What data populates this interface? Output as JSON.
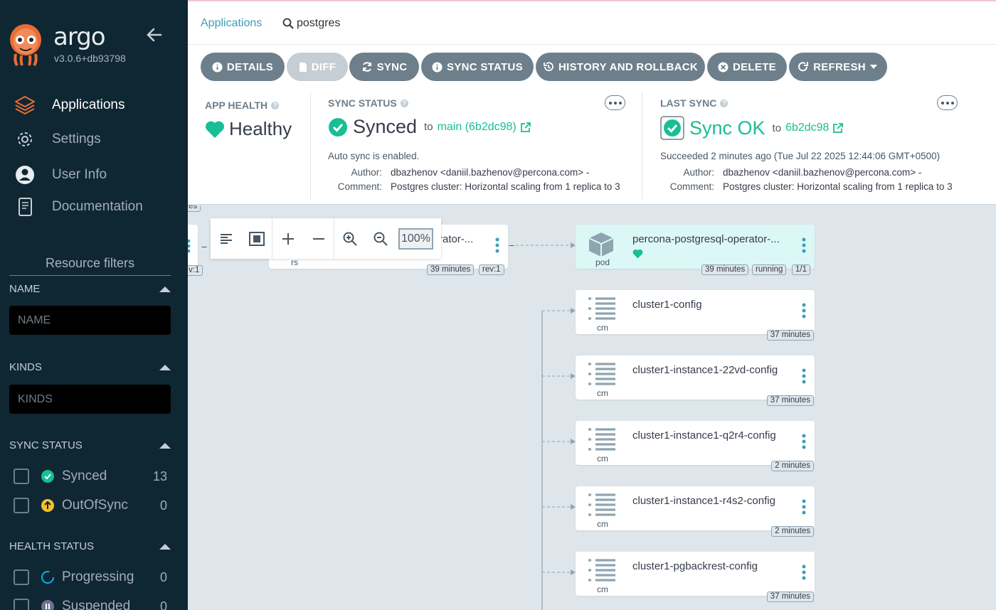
{
  "app": {
    "name": "argo",
    "version": "v3.0.6+db93798"
  },
  "nav": {
    "items": [
      {
        "label": "Applications",
        "icon": "layers-icon",
        "active": true
      },
      {
        "label": "Settings",
        "icon": "gear-icon"
      },
      {
        "label": "User Info",
        "icon": "user-icon"
      },
      {
        "label": "Documentation",
        "icon": "book-icon"
      }
    ]
  },
  "filters": {
    "title": "Resource filters",
    "name": {
      "label": "NAME",
      "placeholder": "NAME"
    },
    "kinds": {
      "label": "KINDS",
      "placeholder": "KINDS"
    },
    "sync_status": {
      "label": "SYNC STATUS",
      "items": [
        {
          "label": "Synced",
          "count": "13",
          "icon": "check-circle-icon",
          "color": "#18be94"
        },
        {
          "label": "OutOfSync",
          "count": "0",
          "icon": "arrow-up-circle-icon",
          "color": "#f4c030"
        }
      ]
    },
    "health_status": {
      "label": "HEALTH STATUS",
      "items": [
        {
          "label": "Progressing",
          "count": "0",
          "icon": "spinner-icon",
          "color": "#0dadea"
        },
        {
          "label": "Suspended",
          "count": "0",
          "icon": "pause-circle-icon",
          "color": "#766f94"
        }
      ]
    }
  },
  "breadcrumb": {
    "root": "Applications",
    "current": "postgres"
  },
  "toolbar": {
    "details": "DETAILS",
    "diff": "DIFF",
    "sync": "SYNC",
    "sync_status": "SYNC STATUS",
    "history": "HISTORY AND ROLLBACK",
    "delete": "DELETE",
    "refresh": "REFRESH"
  },
  "app_health": {
    "label": "APP HEALTH",
    "status": "Healthy",
    "color": "#18be94"
  },
  "sync_status": {
    "label": "SYNC STATUS",
    "status": "Synced",
    "to": "to",
    "revision": "main (6b2dc98)",
    "auto_sync": "Auto sync is enabled.",
    "author_label": "Author:",
    "author": "dbazhenov <daniil.bazhenov@percona.com> -",
    "comment_label": "Comment:",
    "comment": "Postgres cluster: Horizontal scaling from 1 replica to 3"
  },
  "last_sync": {
    "label": "LAST SYNC",
    "status": "Sync OK",
    "to": "to",
    "revision": "6b2dc98",
    "succeeded": "Succeeded 2 minutes ago (Tue Jul 22 2025 12:44:06 GMT+0500)",
    "author_label": "Author:",
    "author": "dbazhenov <daniil.bazhenov@percona.com> -",
    "comment_label": "Comment:",
    "comment": "Postgres cluster: Horizontal scaling from 1 replica to 3"
  },
  "zoom": {
    "level": "100%"
  },
  "graph": {
    "left_partial": {
      "top": "es",
      "rev": "v:1"
    },
    "rs_node": {
      "name": "rator-...",
      "kind": "rs",
      "age": "39 minutes",
      "rev": "rev:1"
    },
    "pod_node": {
      "name": "percona-postgresql-operator-...",
      "kind": "pod",
      "age": "39 minutes",
      "state": "running",
      "ready": "1/1"
    },
    "cm_nodes": [
      {
        "name": "cluster1-config",
        "kind": "cm",
        "age": "37 minutes"
      },
      {
        "name": "cluster1-instance1-22vd-config",
        "kind": "cm",
        "age": "37 minutes"
      },
      {
        "name": "cluster1-instance1-q2r4-config",
        "kind": "cm",
        "age": "2 minutes"
      },
      {
        "name": "cluster1-instance1-r4s2-config",
        "kind": "cm",
        "age": "2 minutes"
      },
      {
        "name": "cluster1-pgbackrest-config",
        "kind": "cm",
        "age": "37 minutes"
      }
    ]
  }
}
